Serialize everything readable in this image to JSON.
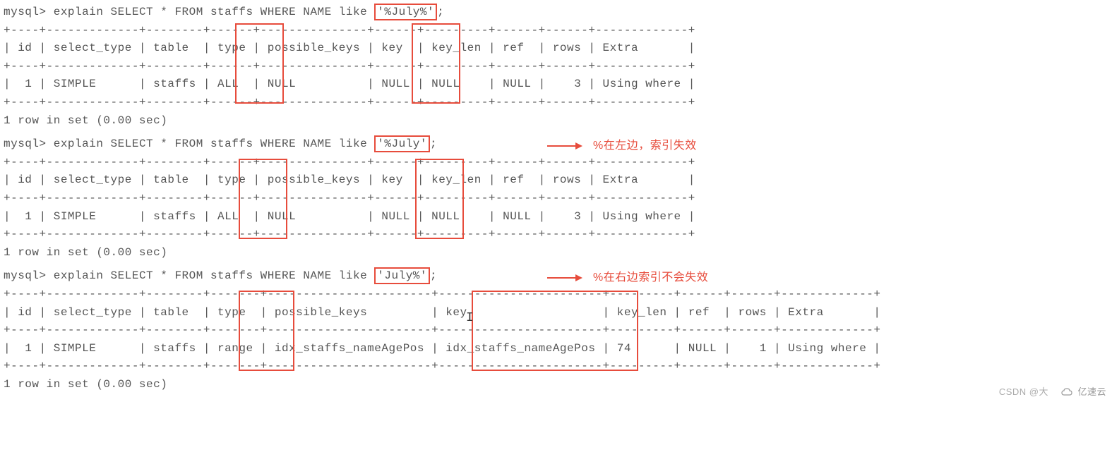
{
  "query1": {
    "prompt": "mysql> ",
    "prefix": "explain SELECT * FROM staffs WHERE NAME like ",
    "highlighted": "'%July%'",
    "suffix": ";",
    "header_sep": "+----+-------------+--------+------+---------------+------+---------+------+------+-------------+",
    "header_row": "| id | select_type | table  | type | possible_keys | key  | key_len | ref  | rows | Extra       |",
    "data_row": "|  1 | SIMPLE      | staffs | ALL  | NULL          | NULL | NULL    | NULL |    3 | Using where |",
    "footer": "1 row in set (0.00 sec)"
  },
  "query2": {
    "prompt": "mysql> ",
    "prefix": "explain SELECT * FROM staffs WHERE NAME like ",
    "highlighted": "'%July'",
    "suffix": ";",
    "header_sep": "+----+-------------+--------+------+---------------+------+---------+------+------+-------------+",
    "header_row": "| id | select_type | table  | type | possible_keys | key  | key_len | ref  | rows | Extra       |",
    "data_row": "|  1 | SIMPLE      | staffs | ALL  | NULL          | NULL | NULL    | NULL |    3 | Using where |",
    "footer": "1 row in set (0.00 sec)",
    "annotation": "%在左边，索引失效"
  },
  "query3": {
    "prompt": "mysql> ",
    "prefix": "explain SELECT * FROM staffs WHERE NAME like ",
    "highlighted": "'July%'",
    "suffix": ";",
    "header_sep": "+----+-------------+--------+-------+-----------------------+-----------------------+---------+------+------+-------------+",
    "header_row": "| id | select_type | table  | type  | possible_keys         | key                   | key_len | ref  | rows | Extra       |",
    "data_row": "|  1 | SIMPLE      | staffs | range | idx_staffs_nameAgePos | idx_staffs_nameAgePos | 74      | NULL |    1 | Using where |",
    "footer": "1 row in set (0.00 sec)",
    "annotation": "%在右边索引不会失效"
  },
  "watermark_csdn": "CSDN @大",
  "watermark_right": "亿速云"
}
